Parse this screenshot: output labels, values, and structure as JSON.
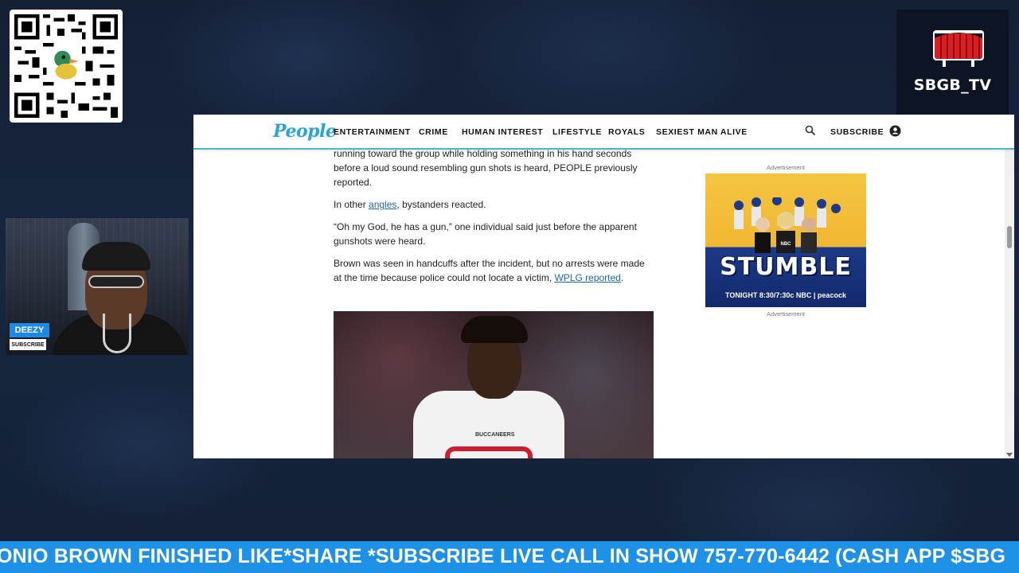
{
  "overlay": {
    "channel_name": "SBGB_TV",
    "host_name": "DEEZY",
    "subscribe_badge": "SUBSCRIBE",
    "ticker": "ONIO BROWN FINISHED LIKE*SHARE *SUBSCRIBE LIVE CALL IN SHOW 757-770-6442 (CASH APP $SBG"
  },
  "site": {
    "brand": "People",
    "nav": [
      "ENTERTAINMENT",
      "CRIME",
      "HUMAN INTEREST",
      "LIFESTYLE",
      "ROYALS",
      "SEXIEST MAN ALIVE"
    ],
    "subscribe": "SUBSCRIBE",
    "icons": [
      "search-icon",
      "account-icon"
    ]
  },
  "article": {
    "p1": "running toward the group while holding something in his hand seconds before a loud sound resembling gun shots is heard, PEOPLE previously reported.",
    "p2_pre": "In other ",
    "p2_link": "angles",
    "p2_post": ", bystanders reacted.",
    "p3": "“Oh my God, he has a gun,” one individual said just before the apparent gunshots were heard.",
    "p4_pre": "Brown was seen in handcuffs after the incident, but no arrests were made at the time because police could not locate a victim, ",
    "p4_link": "WPLG reported",
    "p4_post": ".",
    "photo_jersey_text": "BUCCANEERS"
  },
  "ad": {
    "label_top": "Advertisement",
    "label_bottom": "Advertisement",
    "network": "NBC",
    "title": "STUMBLE",
    "tagline": "TONIGHT 8:30/7:30c  NBC  | peacock"
  },
  "colors": {
    "ticker_bg": "#1e90e6",
    "brand_blue": "#2aa4d6",
    "nav_underline": "#4cb8c4",
    "link": "#1a6aa8"
  }
}
